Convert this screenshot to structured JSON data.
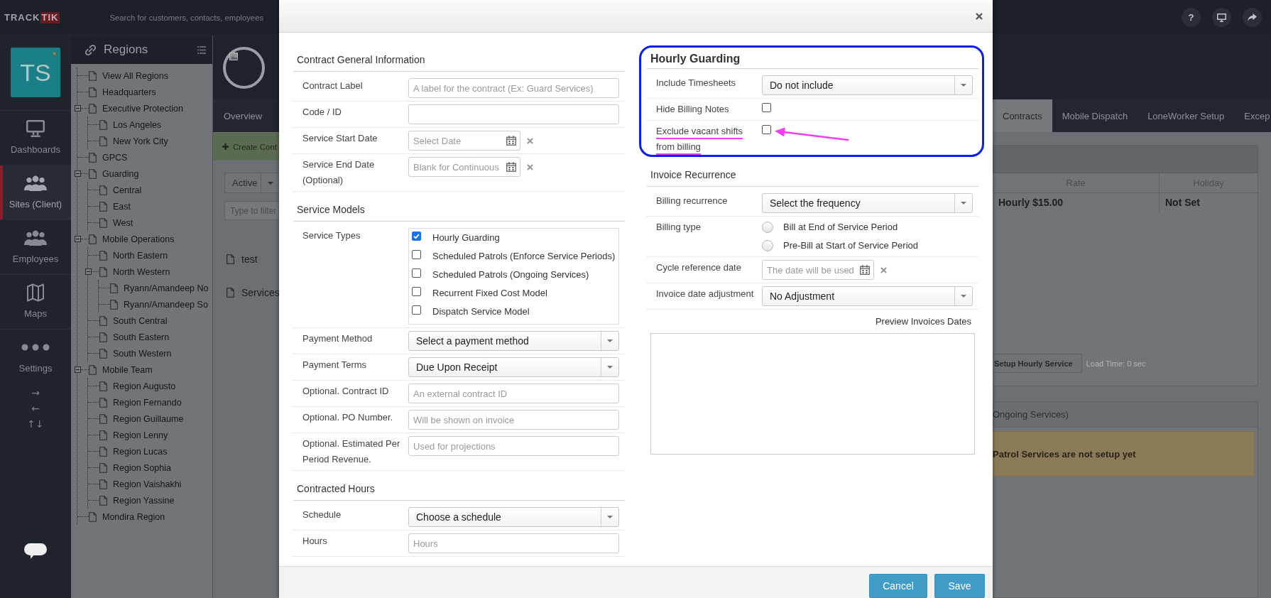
{
  "topbar": {
    "logo": {
      "first": "TRACK",
      "second": "TIK"
    },
    "search": {
      "placeholder": "Search for customers, contacts, employees"
    },
    "help_button": "?"
  },
  "nav": {
    "avatar": "TS",
    "items": [
      {
        "label": "Dashboards",
        "selected": false
      },
      {
        "label": "Sites (Client)",
        "selected": true
      },
      {
        "label": "Employees",
        "selected": false
      },
      {
        "label": "Maps",
        "selected": false
      },
      {
        "label": "Settings",
        "selected": false
      }
    ],
    "arrows": [
      "→",
      "←",
      "↑↓"
    ]
  },
  "regions": {
    "title": "Regions",
    "tree": [
      {
        "label": "View All Regions"
      },
      {
        "label": "Headquarters"
      },
      {
        "label": "Executive Protection",
        "expanded": true,
        "children": [
          {
            "label": "Los Angeles"
          },
          {
            "label": "New York City"
          }
        ]
      },
      {
        "label": "GPCS"
      },
      {
        "label": "Guarding",
        "expanded": true,
        "children": [
          {
            "label": "Central"
          },
          {
            "label": "East"
          },
          {
            "label": "West"
          }
        ]
      },
      {
        "label": "Mobile Operations",
        "expanded": true,
        "children": [
          {
            "label": "North Eastern"
          },
          {
            "label": "North Western",
            "expanded": true,
            "children": [
              {
                "label": "Ryann/Amandeep No"
              },
              {
                "label": "Ryann/Amandeep So"
              }
            ]
          },
          {
            "label": "South Central"
          },
          {
            "label": "South Eastern"
          },
          {
            "label": "South Western"
          }
        ]
      },
      {
        "label": "Mobile Team",
        "expanded": true,
        "children": [
          {
            "label": "Region Augusto"
          },
          {
            "label": "Region Fernando"
          },
          {
            "label": "Region Guillaume"
          },
          {
            "label": "Region Lenny"
          },
          {
            "label": "Region Lucas"
          },
          {
            "label": "Region Sophia"
          },
          {
            "label": "Region Vaishakhi"
          },
          {
            "label": "Region Yassine"
          }
        ]
      },
      {
        "label": "Mondira Region"
      }
    ]
  },
  "main": {
    "tabs": [
      {
        "label": "Overview",
        "selected": false
      },
      {
        "label": "Contracts",
        "selected": true
      },
      {
        "label": "Mobile Dispatch",
        "selected": false
      },
      {
        "label": "LoneWorker Setup",
        "selected": false
      },
      {
        "label": "Excep",
        "selected": false
      }
    ],
    "create_button": "Create Cont",
    "status_filter": "Active",
    "filter": {
      "placeholder": "Type to filter"
    },
    "contracts": [
      {
        "label": "test"
      },
      {
        "label": "Services"
      }
    ],
    "hourly_card": {
      "columns": [
        "Rate",
        "Holiday"
      ],
      "cells": [
        "Hourly $15.00",
        "Not Set"
      ],
      "setup_button": "Setup Hourly Service",
      "load_time": "Load Time: 0 sec"
    },
    "patrol_card": {
      "title": "Ongoing Services)",
      "alert": "Patrol Services are not setup yet"
    }
  },
  "modal": {
    "left_column": {
      "sections": [
        {
          "kind": "group",
          "title": "Contract General Information",
          "fields": [
            {
              "kind": "text",
              "label": "Contract Label",
              "placeholder": "A label for the contract (Ex: Guard Services)"
            },
            {
              "kind": "text",
              "label": "Code / ID"
            },
            {
              "kind": "date",
              "label": "Service Start Date",
              "placeholder": "Select Date"
            },
            {
              "kind": "date",
              "label": "Service End Date (Optional)",
              "placeholder": "Blank for Continuous"
            }
          ]
        },
        {
          "kind": "group",
          "title": "Service Models",
          "fields": [
            {
              "kind": "checklist",
              "label": "Service Types",
              "options": [
                {
                  "label": "Hourly Guarding",
                  "checked": true
                },
                {
                  "label": "Scheduled Patrols (Enforce Service Periods)",
                  "checked": false
                },
                {
                  "label": "Scheduled Patrols (Ongoing Services)",
                  "checked": false
                },
                {
                  "label": "Recurrent Fixed Cost Model",
                  "checked": false
                },
                {
                  "label": "Dispatch Service Model",
                  "checked": false
                }
              ]
            },
            {
              "kind": "select",
              "label": "Payment Method",
              "value": "Select a payment method"
            },
            {
              "kind": "select",
              "label": "Payment Terms",
              "value": "Due Upon Receipt"
            },
            {
              "kind": "text",
              "label": "Optional. Contract ID",
              "placeholder": "An external contract ID"
            },
            {
              "kind": "text",
              "label": "Optional. PO Number.",
              "placeholder": "Will be shown on invoice"
            },
            {
              "kind": "text",
              "label": "Optional. Estimated Per Period Revenue.",
              "placeholder": "Used for projections"
            }
          ]
        },
        {
          "kind": "group",
          "title": "Contracted Hours",
          "fields": [
            {
              "kind": "select",
              "label": "Schedule",
              "value": "Choose a schedule"
            },
            {
              "kind": "text",
              "label": "Hours",
              "placeholder": "Hours"
            }
          ]
        }
      ]
    },
    "right_column": {
      "sections": [
        {
          "kind": "model",
          "title": "Hourly Guarding",
          "highlighted": true,
          "fields": [
            {
              "kind": "select",
              "label": "Include Timesheets",
              "value": "Do not include"
            },
            {
              "kind": "checkbox",
              "label": "Hide Billing Notes",
              "checked": false
            },
            {
              "kind": "checkbox",
              "label": "Exclude vacant shifts from billing",
              "checked": false,
              "annotated": true
            }
          ]
        },
        {
          "kind": "group",
          "title": "Invoice Recurrence",
          "fields": [
            {
              "kind": "select",
              "label": "Billing recurrence",
              "value": "Select the frequency"
            },
            {
              "kind": "radio",
              "label": "Billing type",
              "options": [
                {
                  "label": "Bill at End of Service Period",
                  "selected": false
                },
                {
                  "label": "Pre-Bill at Start of Service Period",
                  "selected": false
                }
              ]
            },
            {
              "kind": "date",
              "label": "Cycle reference date",
              "placeholder": "The date will be used"
            },
            {
              "kind": "select",
              "label": "Invoice date adjustment",
              "value": "No Adjustment"
            }
          ]
        }
      ],
      "preview": {
        "label": "Preview Invoices Dates"
      }
    },
    "footer_buttons": [
      "Cancel",
      "Save"
    ]
  }
}
